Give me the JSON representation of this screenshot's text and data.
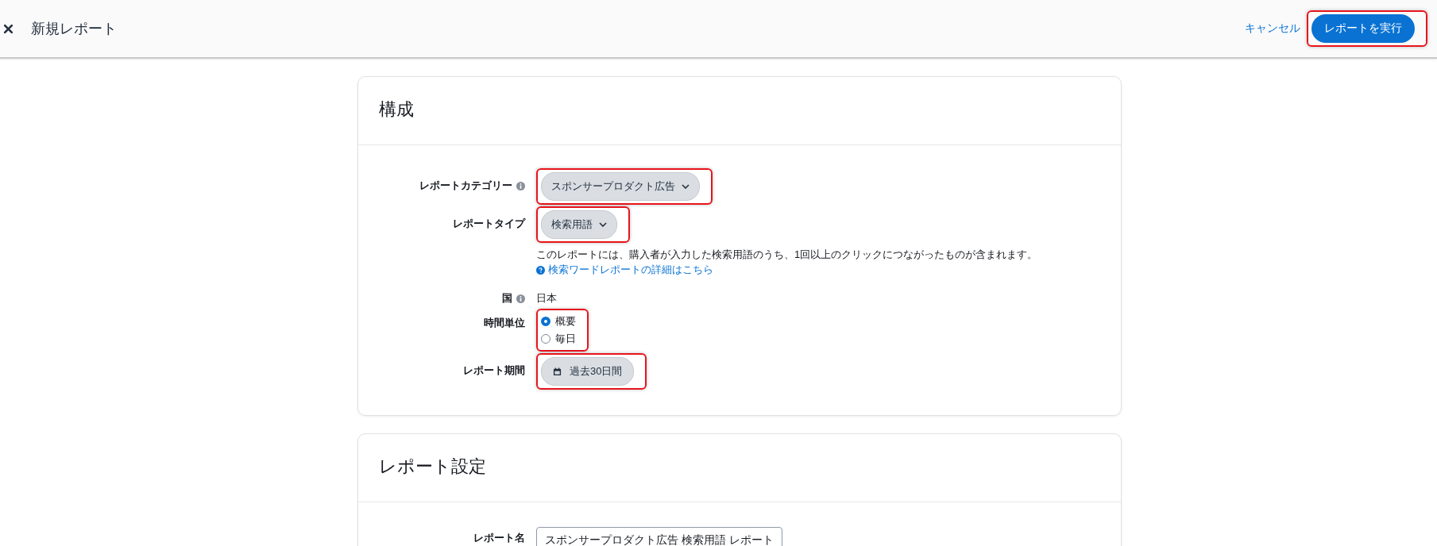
{
  "header": {
    "title": "新規レポート",
    "cancel": "キャンセル",
    "run_button": "レポートを実行",
    "run_highlighted": true
  },
  "config": {
    "title": "構成",
    "fields": [
      {
        "kind": "dropdown",
        "label": "レポートカテゴリー",
        "info": true,
        "value": "スポンサープロダクト広告",
        "highlighted": true
      },
      {
        "kind": "dropdown",
        "label": "レポートタイプ",
        "value": "検索用語",
        "highlighted": true,
        "description": "このレポートには、購入者が入力した検索用語のうち、1回以上のクリックにつながったものが含まれます。",
        "help_link": "検索ワードレポートの詳細はこちら"
      },
      {
        "kind": "text",
        "label": "国",
        "info": true,
        "value": "日本"
      },
      {
        "kind": "radio",
        "label": "時間単位",
        "highlighted": true,
        "options": [
          {
            "label": "概要",
            "selected": true
          },
          {
            "label": "毎日",
            "selected": false
          }
        ]
      },
      {
        "kind": "date",
        "label": "レポート期間",
        "value": "過去30日間",
        "highlighted": true
      }
    ]
  },
  "settings": {
    "title": "レポート設定",
    "fields": [
      {
        "kind": "input",
        "label": "レポート名",
        "value": "スポンサープロダクト広告 検索用語 レポート"
      }
    ]
  }
}
